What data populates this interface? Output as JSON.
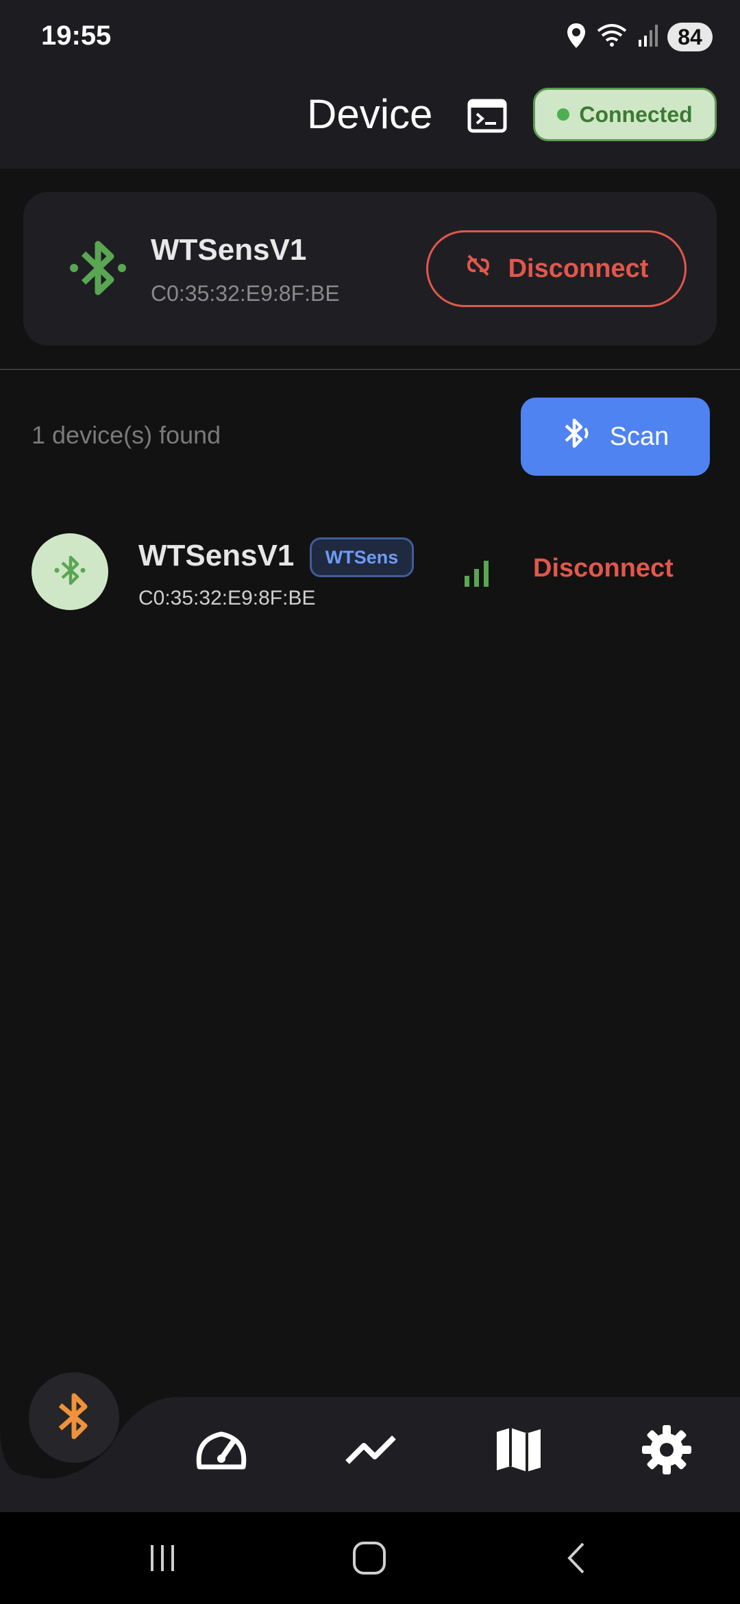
{
  "status_bar": {
    "time": "19:55",
    "battery": "84",
    "icons": [
      "location-icon",
      "wifi-icon",
      "signal-icon",
      "battery-icon"
    ]
  },
  "app_bar": {
    "title": "Device",
    "terminal_icon": "terminal-icon",
    "connection_status": "Connected"
  },
  "connected_device": {
    "name": "WTSensV1",
    "mac": "C0:35:32:E9:8F:BE",
    "disconnect_label": "Disconnect",
    "icon": "bluetooth-connected-icon"
  },
  "scan_section": {
    "found_text": "1 device(s) found",
    "scan_label": "Scan"
  },
  "device_list": [
    {
      "name": "WTSensV1",
      "tag": "WTSens",
      "mac": "C0:35:32:E9:8F:BE",
      "action": "Disconnect",
      "signal_icon": "signal-strength-icon"
    }
  ],
  "bottom_nav": {
    "items": [
      "bluetooth-icon",
      "speedometer-icon",
      "chart-line-icon",
      "map-icon",
      "settings-icon"
    ],
    "active": "bluetooth-icon"
  },
  "colors": {
    "background": "#121212",
    "surface": "#1f1f23",
    "connected_green": "#4caf50",
    "danger_red": "#e2574c",
    "primary_blue": "#4f83f1",
    "active_nav_orange": "#f0923a"
  }
}
